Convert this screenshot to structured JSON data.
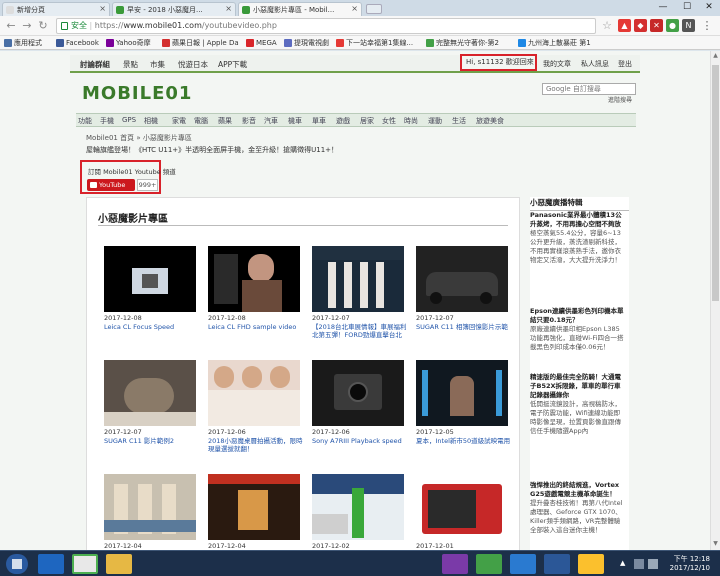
{
  "browser": {
    "tabs": [
      {
        "label": "新增分頁",
        "active": false
      },
      {
        "label": "早安 - 2018 小惡魔月...",
        "active": false
      },
      {
        "label": "小惡魔影片專區 - Mobil...",
        "active": true
      }
    ],
    "new_tab_label": "新增分頁",
    "window_controls": {
      "minimize": "—",
      "maximize": "☐",
      "close": "✕"
    },
    "secure_label": "安全",
    "url_scheme": "https://",
    "url_host": "www.mobile01.com",
    "url_path": "/youtubevideo.php",
    "bookmarks": [
      "應用程式",
      "Facebook",
      "Yahoo奇摩",
      "蘋果日報 | Apple Da",
      "MEGA",
      "提現電視劇",
      "下一站幸福第1集線...",
      "完整無光守著你-第2",
      "九州海上散暴莊 第1"
    ],
    "bookmark_colors": [
      "#4a6fa5",
      "#3b5998",
      "#7b0099",
      "#d32f2f",
      "#d9252a",
      "#5c6bc0",
      "#e53935",
      "#43a047",
      "#1e88e5"
    ]
  },
  "site": {
    "topnav": [
      "討論群組",
      "景點",
      "市集",
      "悅遊日本",
      "APP下載"
    ],
    "user_greeting": "Hi, s11132 歡迎回來",
    "user_links": [
      "我的文章",
      "私人訊息",
      "登出"
    ],
    "logo_text": "MOBILE01",
    "search_placeholder": "Google 自訂搜尋",
    "search_sub": "進階搜尋",
    "categories": [
      "功能",
      "手機",
      "GPS",
      "相機",
      "家電",
      "電腦",
      "蘋果",
      "影音",
      "汽車",
      "機車",
      "單車",
      "遊戲",
      "居家",
      "女性",
      "時尚",
      "運動",
      "生活",
      "旅遊美食"
    ],
    "breadcrumb": [
      "Mobile01 首頁",
      "»",
      "小惡魔影片專區"
    ],
    "notice": "屋輪旗艦登場！《HTC U11+》半透明全面屏手機，金至升級！搶購徵得U11+！",
    "subscribe_title": "訂閱 Mobile01 Youtube 頻道",
    "youtube_label": "YouTube",
    "subscriber_count": "999+"
  },
  "main": {
    "panel_title": "小惡魔影片專區",
    "videos": [
      {
        "date": "2017-12-08",
        "title": "Leica CL Focus Speed"
      },
      {
        "date": "2017-12-08",
        "title": "Leica CL FHD sample video"
      },
      {
        "date": "2017-12-07",
        "title": "【2018台北車展情報】車展福利北第五彈！FORD勁爆直擊台北"
      },
      {
        "date": "2017-12-07",
        "title": "SUGAR C11 相簿回憶影片示範"
      },
      {
        "date": "2017-12-07",
        "title": "SUGAR C11 影片範例2"
      },
      {
        "date": "2017-12-06",
        "title": "2018小惡魔桌曆拍攝活動，限時現量選拔就翻！"
      },
      {
        "date": "2017-12-06",
        "title": "Sony A7RIII Playback speed"
      },
      {
        "date": "2017-12-05",
        "title": "夏本，Intel新市50道級試映電用"
      },
      {
        "date": "2017-12-04",
        "title": ""
      },
      {
        "date": "2017-12-04",
        "title": ""
      },
      {
        "date": "2017-12-02",
        "title": ""
      },
      {
        "date": "2017-12-01",
        "title": ""
      }
    ]
  },
  "sidebar": {
    "title": "小惡魔廣播特輯",
    "items": [
      {
        "title": "Panasonic業界最小體積13公升蒸烤，不用再擔心空間不夠放",
        "desc": "極空蒸氣55.4公分，容量6~13公升更升級，蒸洗渣剔新科技，不用再實樣滾蒸熟手法，邀你衣物定又活潑，大大提升洗淨力！"
      },
      {
        "title": "Epson連續供墨彩色列印機本單結只要0.18元？",
        "desc": "原廠連續供墨印相Epson L385功能再強化，直碰Wi-Fi四合一搭載黑色列印成本僅0.06元！"
      },
      {
        "title": "精速版的最佳完全防騎！大通電子B52X拆限錄，單車的單行車記錄器攝錄你",
        "desc": "低開挺流鏡設計，高視稿防水，電子防震功能，Wifi連線功能即時影像呈現，拉置頁影像直跟傳信任手機隨選App內"
      },
      {
        "title": "強悍推出的終結規進，Vortex G25遊戲電競主機革命誕生！",
        "desc": "提升疊杏桂技術！再第八代Intel處理器、Geforce GTX 1070、Killer頻手頻網路，VR完整體驗全部裝入這台迷你主機！"
      }
    ]
  },
  "taskbar": {
    "time": "下午 12:18",
    "date": "2017/12/10",
    "apps": [
      "ie-icon",
      "chrome-icon",
      "explorer-icon",
      "paint-icon",
      "mobile01-icon",
      "windows-media-icon",
      "word-icon",
      "chrome-alt-icon"
    ]
  }
}
